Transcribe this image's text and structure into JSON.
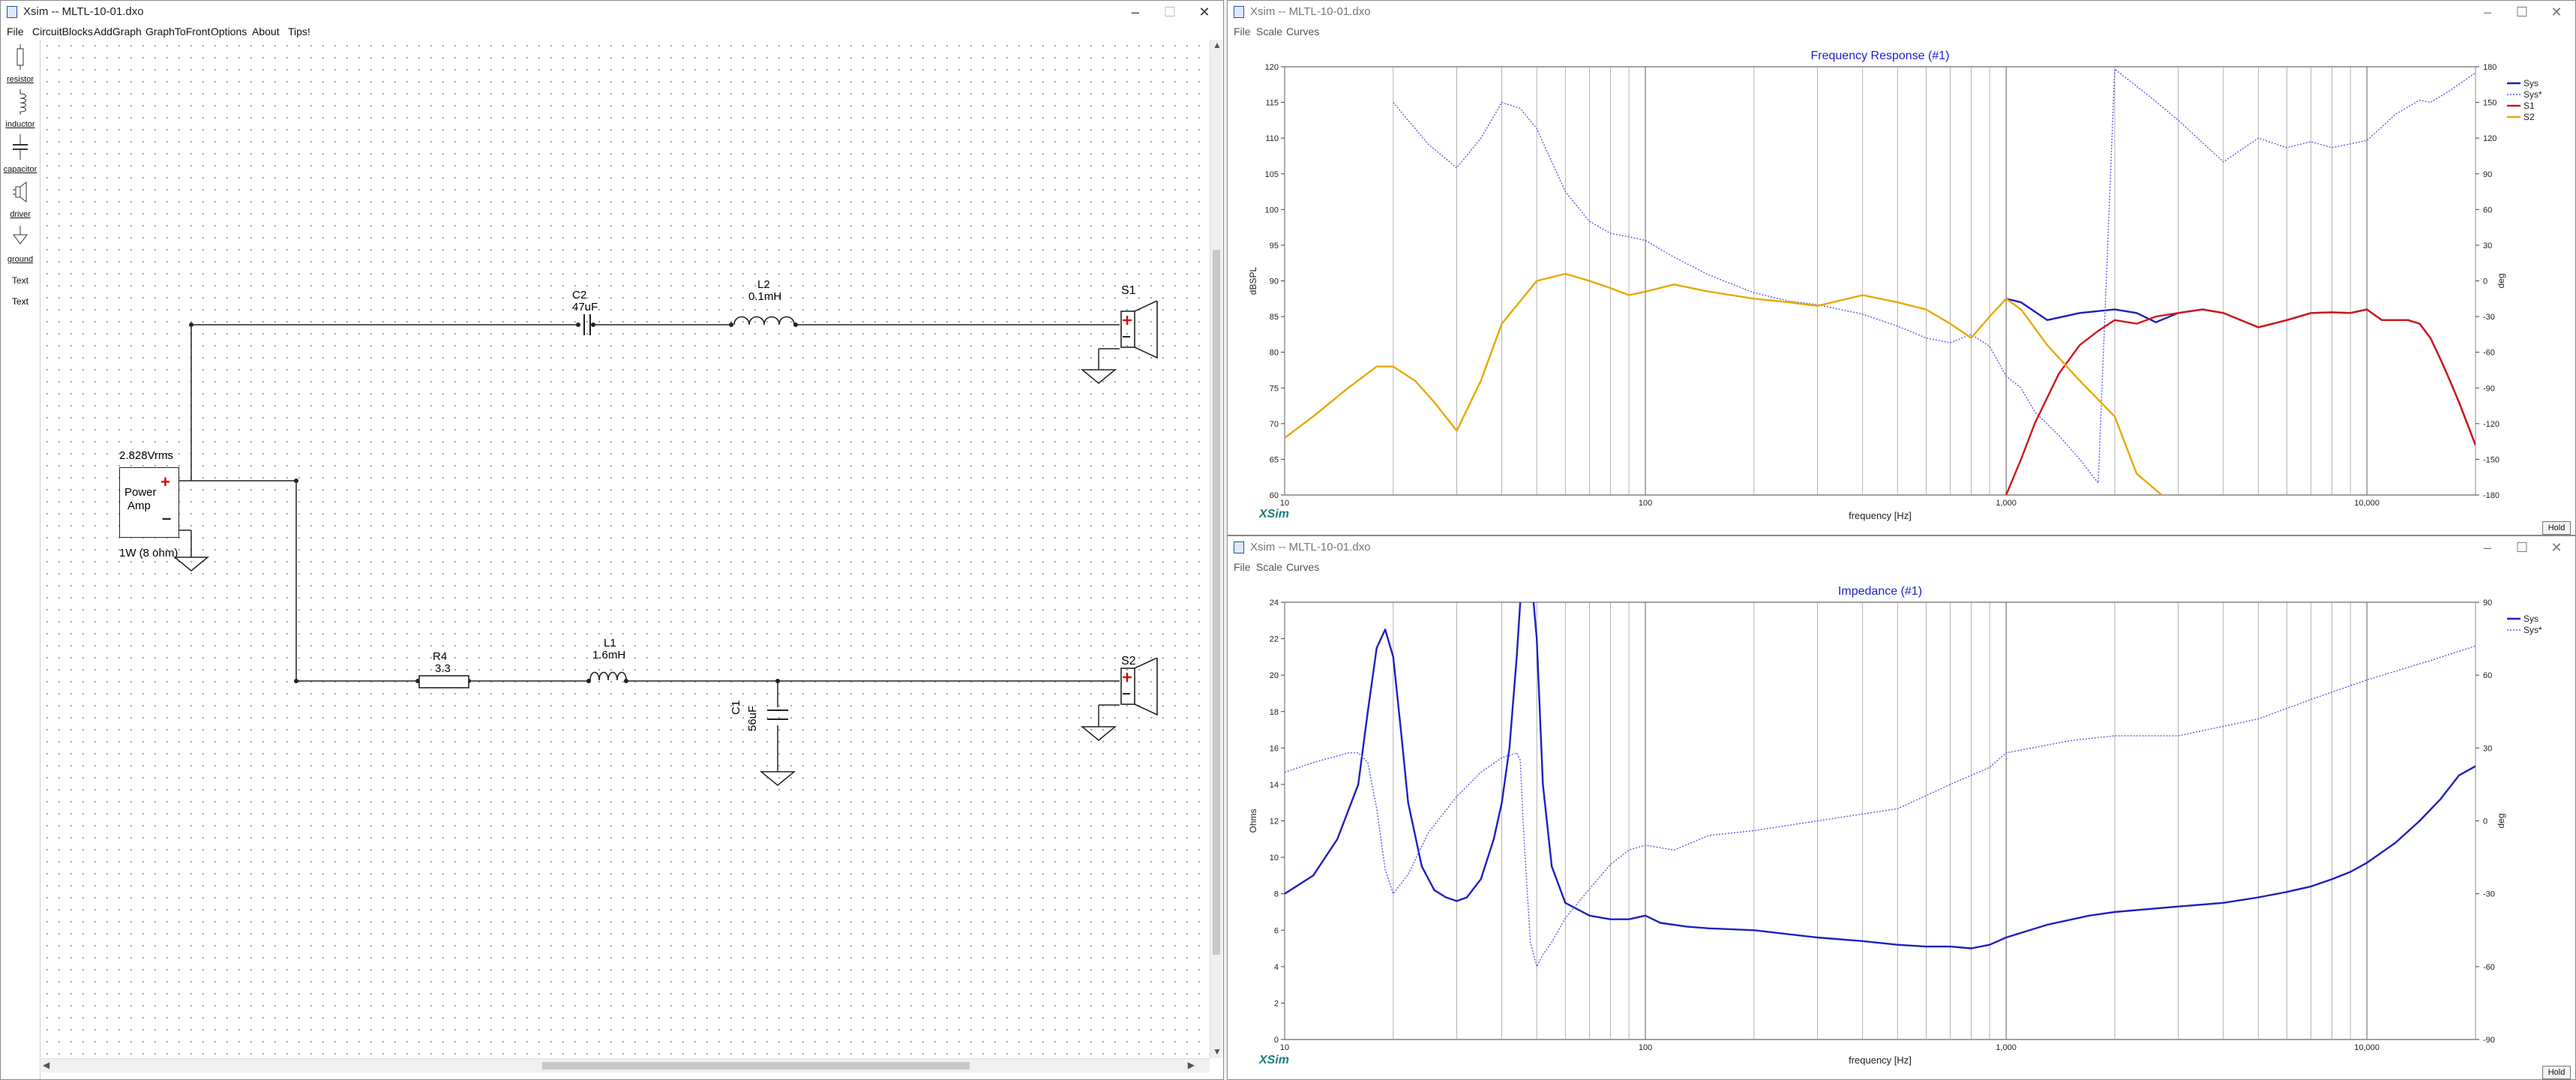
{
  "schematic_window": {
    "title": "Xsim -- MLTL-10-01.dxo",
    "menu": [
      "File",
      "CircuitBlocks",
      "AddGraph",
      "GraphToFront",
      "Options",
      "About",
      "Tips!"
    ],
    "tools": [
      {
        "label": "resistor",
        "icon": "resistor-icon"
      },
      {
        "label": "inductor",
        "icon": "inductor-icon"
      },
      {
        "label": "capacitor",
        "icon": "capacitor-icon"
      },
      {
        "label": "driver",
        "icon": "driver-icon"
      },
      {
        "label": "ground",
        "icon": "ground-icon"
      },
      {
        "label": "Text",
        "icon": "text-tool"
      },
      {
        "label": "Text",
        "icon": "text-tool-link"
      }
    ],
    "components": {
      "c2": {
        "name": "C2",
        "value": "47uF"
      },
      "l2": {
        "name": "L2",
        "value": "0.1mH"
      },
      "s1": {
        "name": "S1"
      },
      "s2": {
        "name": "S2"
      },
      "r4": {
        "name": "R4",
        "value": "3.3"
      },
      "l1": {
        "name": "L1",
        "value": "1.6mH"
      },
      "c1": {
        "name": "C1",
        "value": "56uF"
      },
      "amp": {
        "line1": "Power",
        "line2": "Amp",
        "voltage": "2.828Vrms",
        "power": "1W (8 ohm)"
      }
    }
  },
  "fr_window": {
    "title": "Xsim -- MLTL-10-01.dxo",
    "menu": [
      "File",
      "Scale",
      "Curves"
    ],
    "hold": "Hold",
    "logo": "XSim"
  },
  "imp_window": {
    "title": "Xsim -- MLTL-10-01.dxo",
    "menu": [
      "File",
      "Scale",
      "Curves"
    ],
    "hold": "Hold",
    "logo": "XSim"
  },
  "chart_data": [
    {
      "type": "line",
      "title": "Frequency Response (#1)",
      "xlabel": "frequency [Hz]",
      "ylabel": "dBSPL",
      "y2label": "deg",
      "xscale": "log",
      "xlim": [
        10,
        20000
      ],
      "ylim": [
        60,
        120
      ],
      "y2lim": [
        -180,
        180
      ],
      "x_tick_labels": [
        "10",
        "100",
        "1,000",
        "10,000"
      ],
      "y_ticks": [
        60,
        65,
        70,
        75,
        80,
        85,
        90,
        95,
        100,
        105,
        110,
        115,
        120
      ],
      "y2_ticks": [
        -180,
        -150,
        -120,
        -90,
        -60,
        -30,
        0,
        30,
        60,
        90,
        120,
        150,
        180
      ],
      "legend": [
        "Sys",
        "Sys*",
        "S1",
        "S2"
      ],
      "legend_position": "right",
      "grid": true,
      "colors": {
        "Sys": "#1f1fbf",
        "Sys*": "#5a5ae6",
        "S1": "#d01818",
        "S2": "#e8a800"
      },
      "series": [
        {
          "name": "Sys",
          "axis": "left",
          "style": "solid",
          "x": [
            1000,
            1100,
            1300,
            1600,
            2000,
            2300,
            2600,
            3000,
            3500,
            4000,
            5000,
            6000,
            7000,
            8000,
            9000,
            10000,
            11000,
            12000,
            13000,
            14000,
            15000,
            16000,
            17000,
            18000,
            20000
          ],
          "y": [
            87.5,
            87,
            84.5,
            85.5,
            86,
            85.5,
            84.2,
            85.5,
            86,
            85.5,
            83.5,
            84.5,
            85.5,
            85.6,
            85.5,
            86,
            84.5,
            84.5,
            84.5,
            84,
            82,
            79,
            76,
            73,
            67
          ]
        },
        {
          "name": "Sys*",
          "axis": "right",
          "style": "dotted",
          "x": [
            20,
            25,
            30,
            35,
            40,
            45,
            50,
            60,
            70,
            80,
            90,
            100,
            120,
            150,
            200,
            250,
            300,
            400,
            500,
            600,
            700,
            800,
            900,
            1000,
            1100,
            1200,
            1400,
            1600,
            1800,
            2000,
            2500,
            3000,
            4000,
            5000,
            6000,
            7000,
            8000,
            10000,
            12000,
            14000,
            15000,
            17000,
            20000
          ],
          "y": [
            150,
            115,
            95,
            120,
            150,
            145,
            128,
            75,
            50,
            40,
            37,
            34,
            20,
            5,
            -10,
            -17,
            -20,
            -28,
            -38,
            -48,
            -52,
            -45,
            -55,
            -80,
            -90,
            -110,
            -130,
            -150,
            -170,
            178,
            155,
            135,
            100,
            120,
            112,
            117,
            112,
            118,
            140,
            152,
            150,
            160,
            175
          ]
        },
        {
          "name": "S1",
          "axis": "left",
          "style": "solid",
          "x": [
            1000,
            1100,
            1200,
            1400,
            1600,
            1800,
            2000,
            2300,
            2600,
            3000,
            3500,
            4000,
            5000,
            6000,
            7000,
            8000,
            9000,
            10000,
            11000,
            12000,
            13000,
            14000,
            15000,
            16000,
            17000,
            18000,
            20000
          ],
          "y": [
            60,
            65,
            70,
            77,
            81,
            83,
            84.5,
            84,
            85,
            85.5,
            86,
            85.5,
            83.5,
            84.5,
            85.5,
            85.6,
            85.5,
            86,
            84.5,
            84.5,
            84.5,
            84,
            82,
            79,
            76,
            73,
            67
          ]
        },
        {
          "name": "S2",
          "axis": "left",
          "style": "solid",
          "x": [
            10,
            12,
            15,
            18,
            20,
            23,
            26,
            30,
            35,
            40,
            50,
            60,
            70,
            80,
            90,
            100,
            120,
            150,
            200,
            250,
            300,
            400,
            500,
            600,
            700,
            800,
            900,
            1000,
            1100,
            1300,
            1600,
            2000,
            2300,
            2700
          ],
          "y": [
            68,
            71,
            75,
            78,
            78,
            76,
            73,
            69,
            76,
            84,
            90,
            91,
            90,
            89,
            88,
            88.5,
            89.5,
            88.5,
            87.5,
            87,
            86.5,
            88,
            87,
            86,
            84,
            82,
            85,
            87.5,
            86,
            81,
            76,
            71,
            63,
            60
          ]
        }
      ]
    },
    {
      "type": "line",
      "title": "Impedance (#1)",
      "xlabel": "frequency [Hz]",
      "ylabel": "Ohms",
      "y2label": "deg",
      "xscale": "log",
      "xlim": [
        10,
        20000
      ],
      "ylim": [
        0,
        24
      ],
      "y2lim": [
        -90,
        90
      ],
      "x_tick_labels": [
        "10",
        "100",
        "1,000",
        "10,000"
      ],
      "y_ticks": [
        0,
        2,
        4,
        6,
        8,
        10,
        12,
        14,
        16,
        18,
        20,
        22,
        24
      ],
      "y2_ticks": [
        -90,
        -60,
        -30,
        0,
        30,
        60,
        90
      ],
      "legend": [
        "Sys",
        "Sys*"
      ],
      "legend_position": "right",
      "grid": true,
      "colors": {
        "Sys": "#1f1fbf",
        "Sys*": "#5a5ae6"
      },
      "series": [
        {
          "name": "Sys",
          "axis": "left",
          "style": "solid",
          "x": [
            10,
            12,
            14,
            16,
            17,
            18,
            19,
            20,
            21,
            22,
            24,
            26,
            28,
            30,
            32,
            35,
            38,
            40,
            42,
            44,
            45,
            46,
            48,
            50,
            52,
            55,
            60,
            70,
            80,
            90,
            100,
            110,
            130,
            150,
            200,
            300,
            400,
            500,
            600,
            700,
            800,
            900,
            1000,
            1300,
            1700,
            2000,
            3000,
            4000,
            5000,
            6000,
            7000,
            8000,
            9000,
            10000,
            12000,
            14000,
            16000,
            18000,
            20000
          ],
          "y": [
            8,
            9,
            11,
            14,
            18,
            21.5,
            22.5,
            21,
            17,
            13,
            9.5,
            8.2,
            7.8,
            7.6,
            7.8,
            8.8,
            11,
            13,
            16,
            21,
            24,
            26,
            26,
            22,
            14,
            9.5,
            7.5,
            6.8,
            6.6,
            6.6,
            6.8,
            6.4,
            6.2,
            6.1,
            6,
            5.6,
            5.4,
            5.2,
            5.1,
            5.1,
            5,
            5.2,
            5.6,
            6.3,
            6.8,
            7,
            7.3,
            7.5,
            7.8,
            8.1,
            8.4,
            8.8,
            9.2,
            9.7,
            10.8,
            12,
            13.2,
            14.5,
            15
          ]
        },
        {
          "name": "Sys*",
          "axis": "right",
          "style": "dotted",
          "x": [
            10,
            12,
            15,
            16,
            17,
            18,
            19,
            20,
            22,
            25,
            30,
            35,
            40,
            44,
            45,
            46,
            48,
            50,
            52,
            55,
            60,
            70,
            80,
            90,
            100,
            120,
            150,
            200,
            300,
            500,
            700,
            900,
            1000,
            1500,
            2000,
            3000,
            5000,
            7000,
            10000,
            15000,
            20000
          ],
          "y": [
            20,
            24,
            28,
            28,
            24,
            5,
            -20,
            -30,
            -22,
            -5,
            10,
            20,
            26,
            28,
            25,
            -5,
            -50,
            -60,
            -55,
            -50,
            -40,
            -28,
            -18,
            -12,
            -10,
            -12,
            -6,
            -4,
            0,
            5,
            15,
            22,
            28,
            33,
            35,
            35,
            42,
            50,
            58,
            66,
            72
          ]
        }
      ]
    }
  ]
}
